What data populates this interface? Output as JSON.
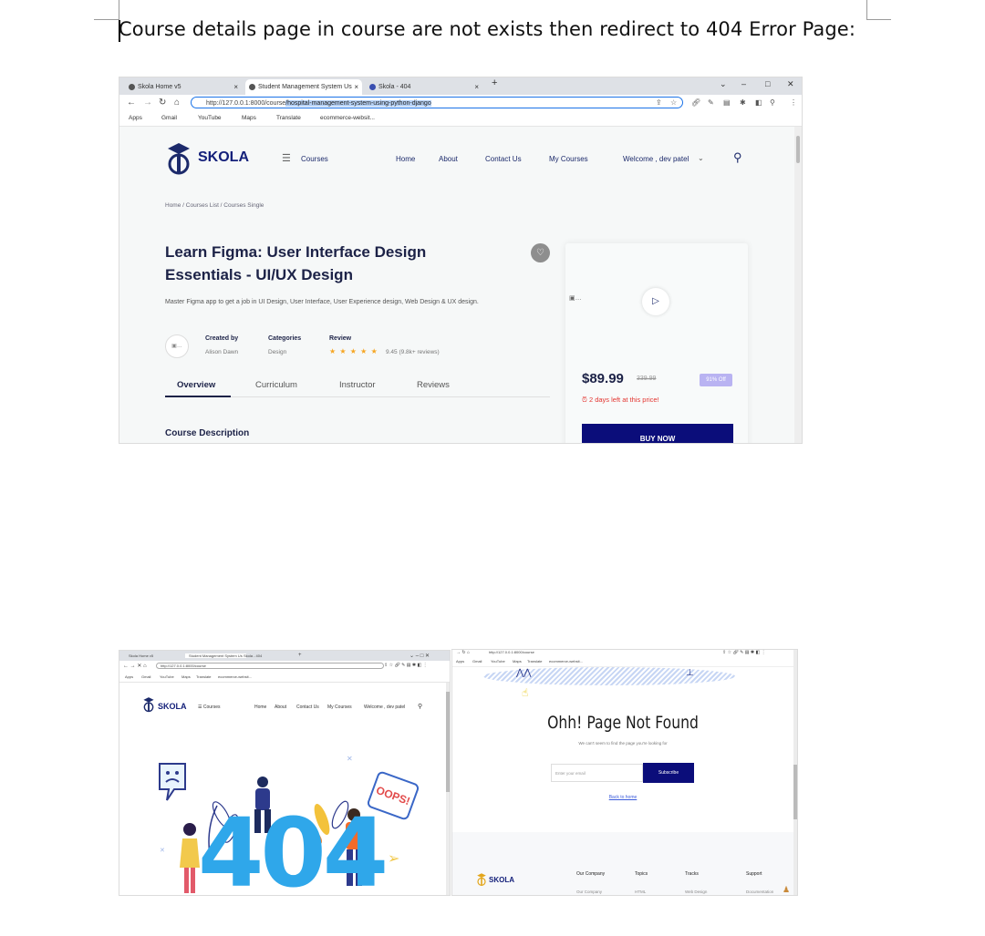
{
  "document": {
    "heading": "Course details page in course are not exists then redirect to 404 Error Page:"
  },
  "browser1": {
    "tabs": [
      {
        "label": "Skola Home v5",
        "close": "×"
      },
      {
        "label": "Student Management System Us",
        "close": "×"
      },
      {
        "label": "Skola - 404",
        "close": "×"
      }
    ],
    "new_tab": "+",
    "url_prefix": "http://127.0.0.1:8000/course",
    "url_selected": "/hospital-management-system-using-python-django",
    "bookmarks": [
      "Apps",
      "Gmail",
      "YouTube",
      "Maps",
      "Translate",
      "ecommerce-websit..."
    ]
  },
  "site": {
    "logo": "SKOLA",
    "courses_menu": "Courses",
    "nav": [
      "Home",
      "About",
      "Contact Us",
      "My Courses"
    ],
    "welcome": "Welcome , dev patel",
    "breadcrumb": "Home  /  Courses List  /  Courses Single",
    "course_title": "Learn Figma: User Interface Design Essentials - UI/UX Design",
    "course_desc": "Master Figma app to get a job in UI Design, User Interface, User Experience design, Web Design & UX design.",
    "created_by_label": "Created by",
    "created_by_value": "Alison Dawn",
    "categories_label": "Categories",
    "categories_value": "Design",
    "review_label": "Review",
    "stars": "★ ★ ★ ★ ★",
    "rating_text": "9.45 (9.8k+ reviews)",
    "tabs": [
      "Overview",
      "Curriculum",
      "Instructor",
      "Reviews"
    ],
    "description_heading": "Course Description",
    "price": "$89.99",
    "old_price": "339.99",
    "off_badge": "91% Off",
    "days_left": "2 days left at this price!",
    "buy_button": "BUY NOW"
  },
  "page404": {
    "big_text": "404",
    "oops": "OOPS!",
    "title": "Ohh! Page Not Found",
    "subtitle": "We can't seem to find the page you're looking for",
    "input_placeholder": "Enter your email",
    "subscribe": "Subscribe",
    "back_link": "Back to home",
    "footer_logo": "SKOLA",
    "footer_heads": [
      "Our Company",
      "Topics",
      "Tracks",
      "Support"
    ],
    "footer_values": [
      "Our Company",
      "HTML",
      "Web Design",
      "Documentation"
    ]
  }
}
